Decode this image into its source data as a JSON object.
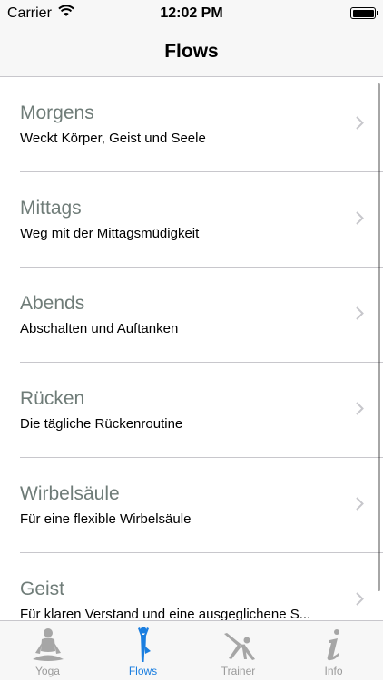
{
  "status_bar": {
    "carrier": "Carrier",
    "time": "12:02 PM"
  },
  "nav": {
    "title": "Flows"
  },
  "list": {
    "items": [
      {
        "title": "Morgens",
        "subtitle": "Weckt Körper, Geist und Seele"
      },
      {
        "title": "Mittags",
        "subtitle": "Weg mit der Mittagsmüdigkeit"
      },
      {
        "title": "Abends",
        "subtitle": "Abschalten und Auftanken"
      },
      {
        "title": "Rücken",
        "subtitle": "Die tägliche Rückenroutine"
      },
      {
        "title": "Wirbelsäule",
        "subtitle": "Für eine flexible Wirbelsäule"
      },
      {
        "title": "Geist",
        "subtitle": "Für klaren Verstand und eine ausgeglichene S..."
      }
    ]
  },
  "tabbar": {
    "tabs": [
      {
        "label": "Yoga",
        "icon": "meditation-icon",
        "active": false
      },
      {
        "label": "Flows",
        "icon": "standing-pose-icon",
        "active": true
      },
      {
        "label": "Trainer",
        "icon": "stretch-pose-icon",
        "active": false
      },
      {
        "label": "Info",
        "icon": "info-icon",
        "active": false
      }
    ]
  },
  "colors": {
    "accent": "#1a7ee0",
    "row_title": "#6f7c78",
    "inactive_tab": "#9a9a9a"
  }
}
